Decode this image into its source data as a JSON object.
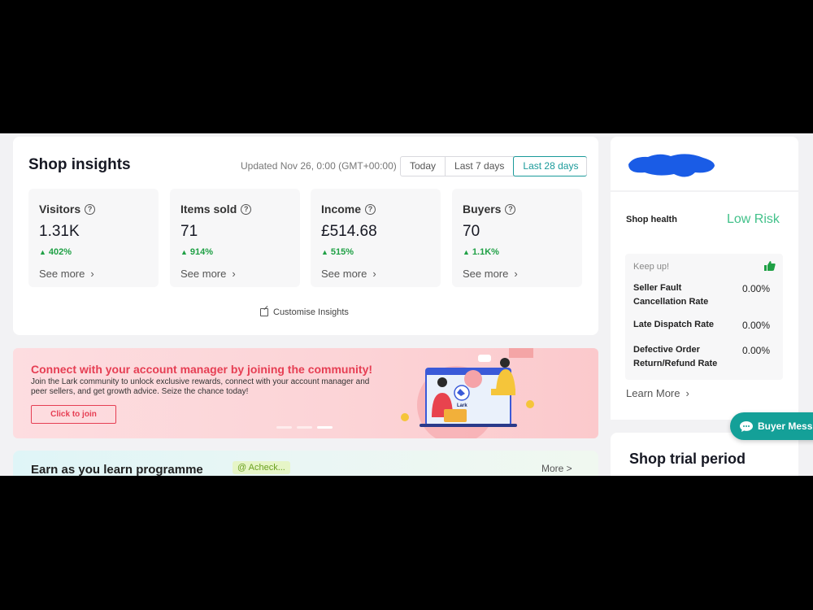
{
  "insights": {
    "title": "Shop insights",
    "updated": "Updated Nov 26, 0:00 (GMT+00:00)",
    "ranges": [
      "Today",
      "Last 7 days",
      "Last 28 days"
    ],
    "active_range": "Last 28 days",
    "metrics": [
      {
        "label": "Visitors",
        "value": "1.31K",
        "change": "402%",
        "see_more": "See more"
      },
      {
        "label": "Items sold",
        "value": "71",
        "change": "914%",
        "see_more": "See more"
      },
      {
        "label": "Income",
        "value": "£514.68",
        "change": "515%",
        "see_more": "See more"
      },
      {
        "label": "Buyers",
        "value": "70",
        "change": "1.1K%",
        "see_more": "See more"
      }
    ],
    "customise": "Customise Insights"
  },
  "banner": {
    "title": "Connect with your account manager by joining the community!",
    "text": "Join the Lark community to unlock exclusive rewards, connect with your account manager and peer sellers, and get growth advice. Seize the chance today!",
    "button": "Click to join",
    "lark_label": "Lark"
  },
  "earn": {
    "title": "Earn as you learn programme",
    "badge": "@ Acheck...",
    "more": "More >"
  },
  "health": {
    "label": "Shop health",
    "value": "Low Risk",
    "keepup": "Keep up!",
    "rows": [
      {
        "label": "Seller Fault Cancellation Rate",
        "value": "0.00%"
      },
      {
        "label": "Late Dispatch Rate",
        "value": "0.00%"
      },
      {
        "label": "Defective Order Return/Refund Rate",
        "value": "0.00%"
      }
    ],
    "learn_more": "Learn More"
  },
  "trial": {
    "title": "Shop trial period"
  },
  "buyer_messages": {
    "label": "Buyer Mess"
  },
  "colors": {
    "accent": "#1a9a9a",
    "green": "#1fa045",
    "risk": "#42c18a",
    "banner_red": "#e63e53",
    "redaction": "#1a5ce6"
  }
}
